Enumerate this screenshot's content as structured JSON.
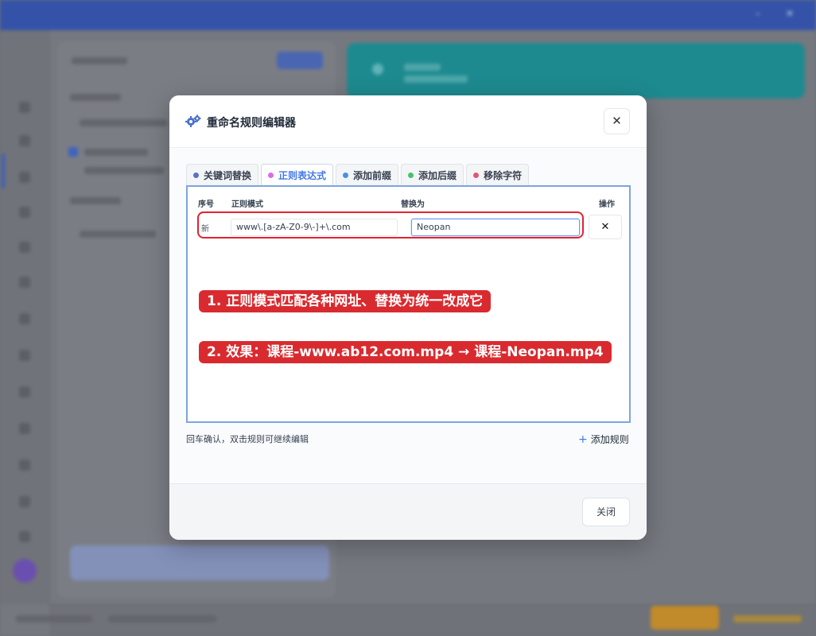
{
  "dialog": {
    "title": "重命名规则编辑器",
    "close_symbol": "✕",
    "tabs": [
      {
        "label": "关键词替换",
        "dot_color": "#5b6fc7",
        "active": false
      },
      {
        "label": "正则表达式",
        "dot_color": "#d86de8",
        "active": true
      },
      {
        "label": "添加前缀",
        "dot_color": "#4a90e2",
        "active": false
      },
      {
        "label": "添加后缀",
        "dot_color": "#43c36e",
        "active": false
      },
      {
        "label": "移除字符",
        "dot_color": "#e0577a",
        "active": false
      }
    ],
    "columns": {
      "index": "序号",
      "pattern": "正则模式",
      "replace": "替换为",
      "action": "操作"
    },
    "rule": {
      "index": "新",
      "pattern": "www\\.[a-zA-Z0-9\\-]+\\.com",
      "replace": "Neopan",
      "delete_symbol": "✕"
    },
    "hint": "回车确认，双击规则可继续编辑",
    "add_rule_label": "添加规则",
    "close_button_label": "关闭"
  },
  "annotations": [
    "1. 正则模式匹配各种网址、替换为统一改成它",
    "2. 效果：课程-www.ab12.com.mp4 → 课程-Neopan.mp4"
  ],
  "colors": {
    "accent": "#4378e6",
    "annotation_red": "#d92b2f"
  }
}
